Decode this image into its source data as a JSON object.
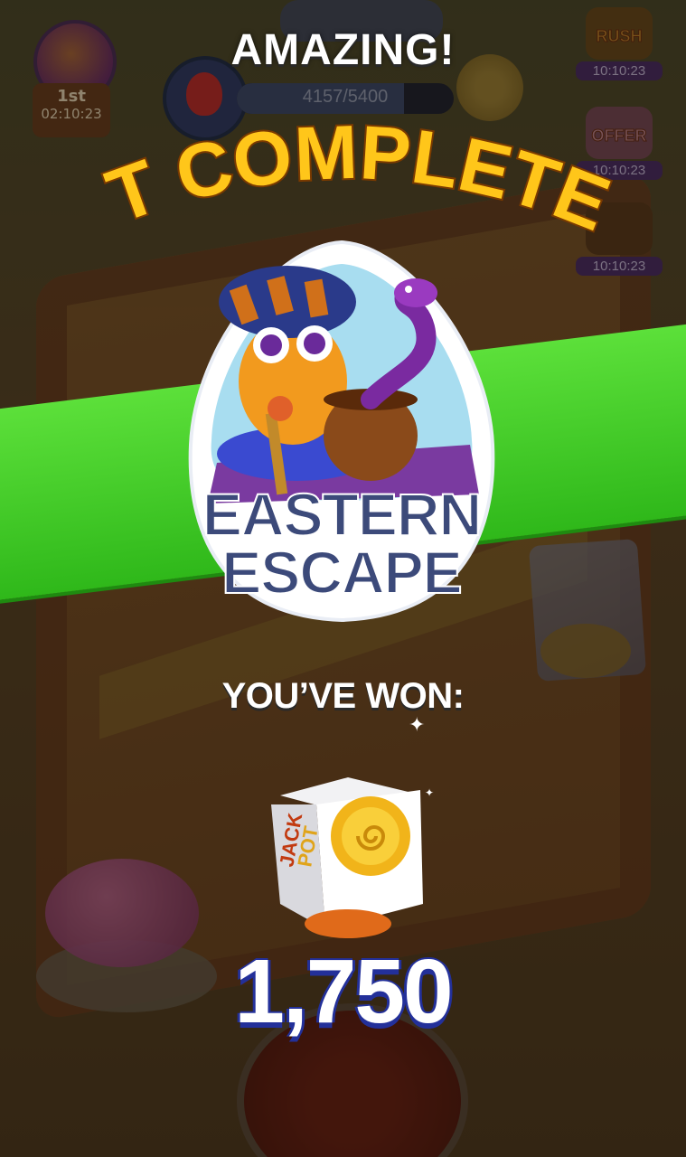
{
  "hud": {
    "rank_place": "1st",
    "rank_timer": "02:10:23",
    "progress_text": "4157/5400",
    "progress_fraction": 0.77
  },
  "side_events": [
    {
      "tag": "RUSH",
      "timer": "10:10:23",
      "color": "#c98a2a"
    },
    {
      "tag": "OFFER",
      "timer": "10:10:23",
      "color": "#c98a9a"
    },
    {
      "tag": "",
      "timer": "10:10:23",
      "color": "#8a6a3a"
    }
  ],
  "popup": {
    "headline": "AMAZING!",
    "title": "SET COMPLETED!",
    "card_name_line1": "EASTERN",
    "card_name_line2": "ESCAPE",
    "won_label": "YOU’VE WON:",
    "reward_amount": "1,750",
    "reward_icon": "dice-icon"
  },
  "colors": {
    "banner_green": "#3ecb24",
    "title_gold": "#ffc61a",
    "card_text": "#3c4a7a",
    "amount_outline": "#23309a"
  }
}
